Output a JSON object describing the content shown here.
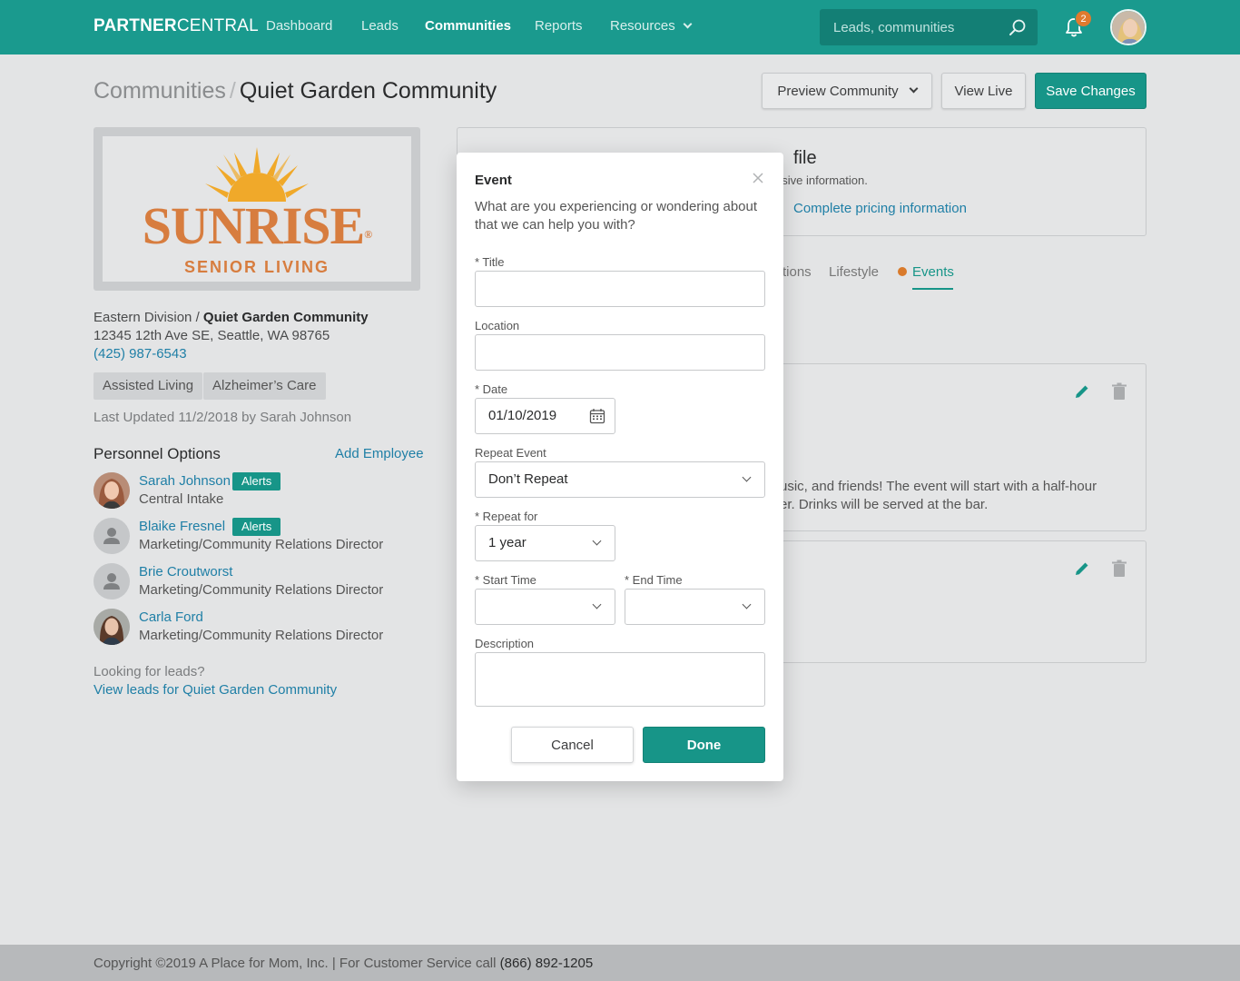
{
  "nav": {
    "brand_bold": "PARTNER",
    "brand_light": "CENTRAL",
    "links": [
      "Dashboard",
      "Leads",
      "Communities",
      "Reports",
      "Resources"
    ],
    "active": "Communities",
    "search_placeholder": "Leads, communities",
    "notification_count": "2"
  },
  "header": {
    "breadcrumb_root": "Communities",
    "breadcrumb_sep": "/",
    "breadcrumb_current": "Quiet Garden Community",
    "preview_label": "Preview Community",
    "view_live_label": "View Live",
    "save_label": "Save Changes"
  },
  "logo": {
    "word": "SUNRISE",
    "registered": "®",
    "sub": "SENIOR LIVING",
    "color": "#d77d3f"
  },
  "community": {
    "division": "Eastern Division",
    "division_sep": "/",
    "name": "Quiet Garden Community",
    "address": "12345 12th Ave SE, Seattle, WA 98765",
    "phone": "(425) 987-6543",
    "tags": [
      "Assisted Living",
      "Alzheimer’s Care"
    ],
    "last_updated": "Last Updated 11/2/2018 by Sarah Johnson"
  },
  "personnel": {
    "title": "Personnel Options",
    "add_label": "Add Employee",
    "alerts_label": "Alerts",
    "people": [
      {
        "name": "Sarah Johnson",
        "role": "Central Intake",
        "alerts": true
      },
      {
        "name": "Blaike Fresnel",
        "role": "Marketing/Community Relations Director",
        "alerts": true
      },
      {
        "name": "Brie Croutworst",
        "role": "Marketing/Community Relations Director",
        "alerts": false
      },
      {
        "name": "Carla Ford",
        "role": "Marketing/Community Relations Director",
        "alerts": false
      }
    ]
  },
  "leads": {
    "prompt": "Looking for leads?",
    "link": "View leads for Quiet Garden Community"
  },
  "profile": {
    "title_fragment": "file",
    "desc_fragment": "nsive information.",
    "pricing_link": "Complete pricing information"
  },
  "tabs": {
    "partial": "tions",
    "lifestyle": "Lifestyle",
    "events": "Events",
    "dot_color": "#d97a2b"
  },
  "event_card": {
    "line1": "usic, and friends! The event will start with a half-hour",
    "line2": "er. Drinks will be served at the bar."
  },
  "modal": {
    "title": "Event",
    "subtitle": "What are you experiencing or wondering about that we can help you with?",
    "title_label": "* Title",
    "title_value": "",
    "location_label": "Location",
    "location_value": "",
    "date_label": "* Date",
    "date_value": "01/10/2019",
    "repeat_label": "Repeat Event",
    "repeat_value": "Don’t Repeat",
    "repeat_for_label": "* Repeat for",
    "repeat_for_value": "1 year",
    "start_label": "* Start Time",
    "start_value": "",
    "end_label": "* End Time",
    "end_value": "",
    "description_label": "Description",
    "description_value": "",
    "cancel_label": "Cancel",
    "done_label": "Done"
  },
  "footer": {
    "text": "Copyright ©2019 A Place for Mom, Inc. | For Customer Service call",
    "phone": "(866) 892-1205"
  },
  "colors": {
    "teal": "#1a9a8e",
    "accent_orange": "#e07a2e",
    "link_blue": "#1f7fa6"
  }
}
